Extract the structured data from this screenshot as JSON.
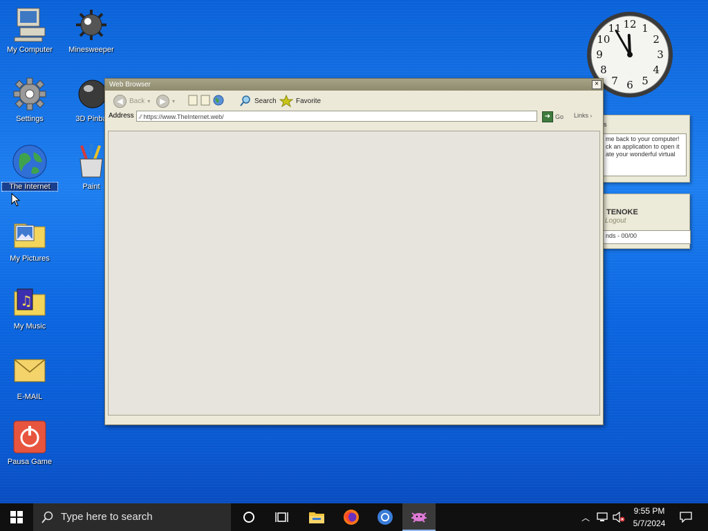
{
  "desktop": {
    "icons": [
      {
        "label": "My Computer"
      },
      {
        "label": "Minesweeper"
      },
      {
        "label": "Settings"
      },
      {
        "label": "3D Pinba"
      },
      {
        "label": "The Internet"
      },
      {
        "label": "Paint"
      },
      {
        "label": "My Pictures"
      },
      {
        "label": "My Music"
      },
      {
        "label": "E-MAIL"
      },
      {
        "label": "Pausa Game"
      }
    ]
  },
  "clock_widget": {
    "numbers": [
      "12",
      "1",
      "2",
      "3",
      "4",
      "5",
      "6",
      "7",
      "8",
      "9",
      "10",
      "11"
    ],
    "time": {
      "hour": 11,
      "minute": 55
    }
  },
  "notes_widget": {
    "title_fragment": "s",
    "text_lines": [
      "me back to your computer!",
      "ck an application to open it",
      "ate your wonderful virtual"
    ]
  },
  "user_widget": {
    "header_fragment": "",
    "name": "TENOKE",
    "logout": "Logout",
    "stats": "nds - 00/00"
  },
  "browser": {
    "title": "Web Browser",
    "close": "×",
    "toolbar": {
      "back": "Back",
      "search": "Search",
      "favorite": "Favorite"
    },
    "address": {
      "label": "Address",
      "url": "https://www.TheInternet.web/",
      "go": "Go",
      "links": "Links"
    }
  },
  "taskbar": {
    "search_placeholder": "Type here to search",
    "time": "9:55 PM",
    "date": "5/7/2024"
  },
  "colors": {
    "desktop_blue": "#1e7ff0",
    "window_face": "#ece9d8",
    "taskbar": "#101010"
  }
}
